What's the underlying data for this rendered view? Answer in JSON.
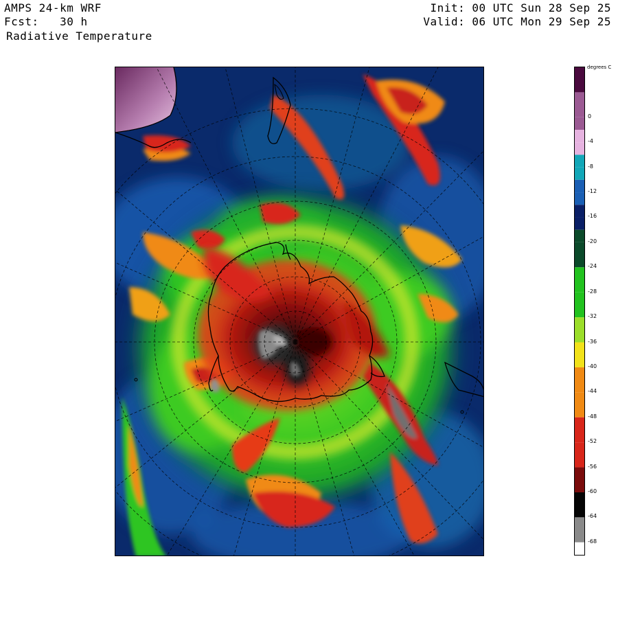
{
  "header": {
    "model": "AMPS 24-km WRF",
    "forecast": "Fcst:   30 h",
    "field": "Radiative Temperature",
    "init": "Init: 00 UTC Sun 28 Sep 25",
    "valid": "Valid: 06 UTC Mon 29 Sep 25"
  },
  "colorbar": {
    "units": "degrees C",
    "min": -70,
    "max": 8,
    "ticks": [
      "0",
      "-4",
      "-8",
      "-12",
      "-16",
      "-20",
      "-24",
      "-28",
      "-32",
      "-36",
      "-40",
      "-44",
      "-48",
      "-52",
      "-56",
      "-60",
      "-64",
      "-68"
    ],
    "colors": {
      "warm_top": "#4a0a3e",
      "magenta": "#9b5a93",
      "pink": "#e6b3e0",
      "cyan": "#12a7b8",
      "blue": "#1a5fb4",
      "navy": "#0a1f66",
      "darkgreen": "#0b4a2a",
      "green": "#22c21f",
      "lime": "#9bde2a",
      "yellow": "#f2e21a",
      "orange": "#f08a14",
      "red": "#d8261a",
      "darkred": "#7a0c0c",
      "black": "#050505",
      "gray": "#8a8a8a",
      "white": "#ffffff"
    }
  }
}
